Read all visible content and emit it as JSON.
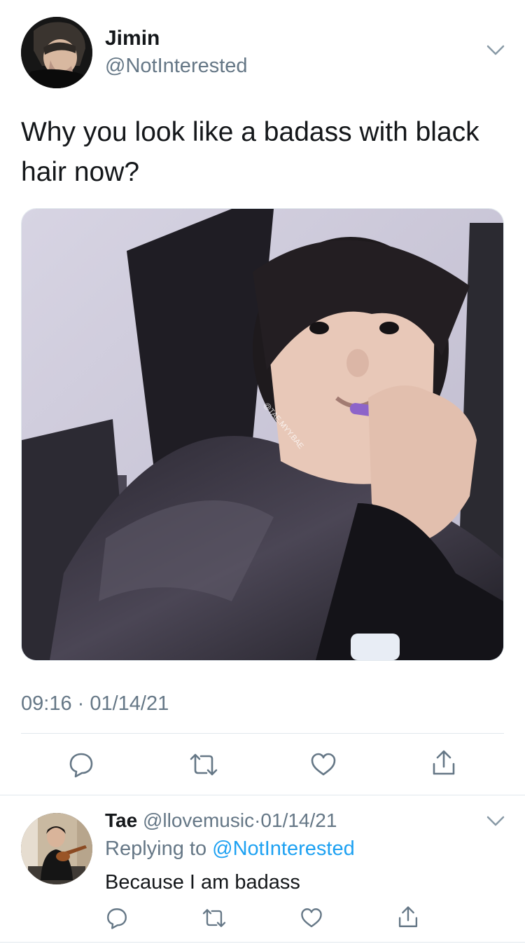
{
  "tweet": {
    "author_name": "Jimin",
    "author_handle": "@NotInterested",
    "text": "Why you look like a badass with black hair now?",
    "photo_watermark": "@TAE.MYY.BAE",
    "timestamp": "09:16 · 01/14/21",
    "menu_icon": "chevron-down-icon",
    "actions": [
      "reply-icon",
      "retweet-icon",
      "like-icon",
      "share-icon"
    ]
  },
  "reply": {
    "author_name": "Tae",
    "author_handle": "@llovemusic",
    "separator": "·",
    "date": "01/14/21",
    "replying_prefix": "Replying to",
    "replying_handle": "@NotInterested",
    "text": "Because I am badass",
    "menu_icon": "chevron-down-icon",
    "actions": [
      "reply-icon",
      "retweet-icon",
      "like-icon",
      "share-icon"
    ]
  },
  "colors": {
    "text": "#14171a",
    "muted": "#657786",
    "link": "#1da1f2",
    "divider": "#e1e8ed"
  }
}
